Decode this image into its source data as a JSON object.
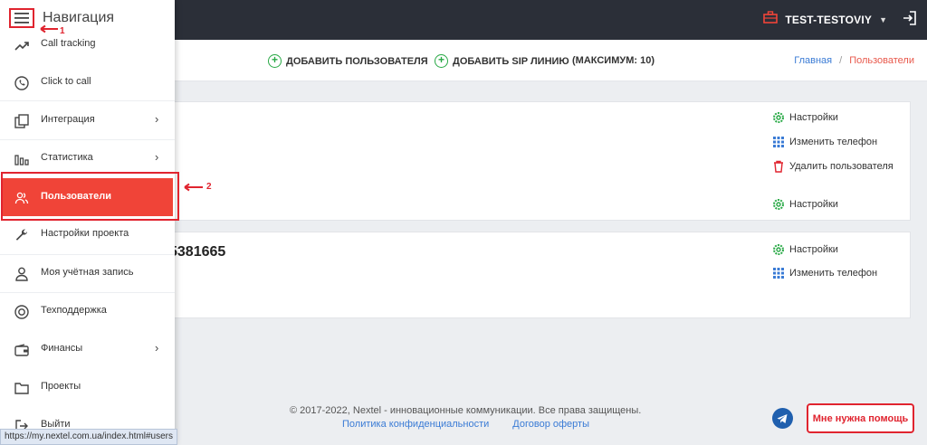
{
  "topbar": {
    "account_name": "TEST-TESTOVIY"
  },
  "actions": {
    "add_user": "ДОБАВИТЬ ПОЛЬЗОВАТЕЛЯ",
    "add_sip": "ДОБАВИТЬ SIP ЛИНИЮ",
    "max_note": "(МАКСИМУМ: 10)"
  },
  "breadcrumb": {
    "home": "Главная",
    "separator": "/",
    "current": "Пользователи"
  },
  "cards": [
    {
      "phone": "",
      "commands": {
        "settings": "Настройки",
        "change_phone": "Изменить телефон",
        "delete_user": "Удалить пользователя",
        "settings_2": "Настройки"
      }
    },
    {
      "phone": "5381665",
      "commands": {
        "settings": "Настройки",
        "change_phone": "Изменить телефон"
      }
    }
  ],
  "footer": {
    "copyright": "© 2017-2022, Nextel - инновационные коммуникации. Все права защищены.",
    "privacy": "Политика конфиденциальности",
    "offer": "Договор оферты",
    "help_button": "Мне нужна помощь"
  },
  "sidebar": {
    "title": "Навигация",
    "items": [
      {
        "label": "Call tracking",
        "icon": "trend-icon"
      },
      {
        "label": "Click to call",
        "icon": "phone-icon"
      },
      {
        "label": "Интеграция",
        "icon": "integration-icon",
        "has_submenu": true
      },
      {
        "label": "Статистика",
        "icon": "bar-chart-icon",
        "has_submenu": true
      },
      {
        "label": "Пользователи",
        "icon": "users-icon",
        "active": true
      },
      {
        "label": "Настройки проекта",
        "icon": "wrench-icon"
      },
      {
        "label": "Моя учётная запись",
        "icon": "user-icon"
      },
      {
        "label": "Техподдержка",
        "icon": "support-icon"
      },
      {
        "label": "Финансы",
        "icon": "wallet-icon",
        "has_submenu": true
      },
      {
        "label": "Проекты",
        "icon": "folder-icon"
      },
      {
        "label": "Выйти",
        "icon": "logout-icon"
      }
    ],
    "submenu_arrow": "›"
  },
  "annotations": {
    "one": "1",
    "two": "2"
  },
  "status_bar": {
    "url": "https://my.nextel.com.ua/index.html#users"
  },
  "colors": {
    "accent_red": "#f04438",
    "topbar": "#2b2f38",
    "link_blue": "#3a7bd5",
    "green": "#27a844",
    "annotation_red": "#e0242f"
  }
}
